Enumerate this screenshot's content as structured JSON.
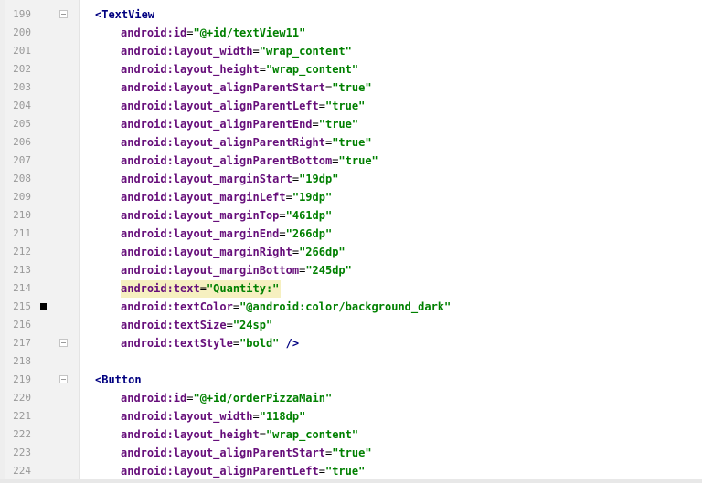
{
  "editor": {
    "lines": [
      {
        "num": "199",
        "kind": "tag",
        "text": "<TextView",
        "fold": true
      },
      {
        "num": "200",
        "kind": "attr",
        "name": "android:id",
        "value": "\"@+id/textView11\""
      },
      {
        "num": "201",
        "kind": "attr",
        "name": "android:layout_width",
        "value": "\"wrap_content\""
      },
      {
        "num": "202",
        "kind": "attr",
        "name": "android:layout_height",
        "value": "\"wrap_content\""
      },
      {
        "num": "203",
        "kind": "attr",
        "name": "android:layout_alignParentStart",
        "value": "\"true\""
      },
      {
        "num": "204",
        "kind": "attr",
        "name": "android:layout_alignParentLeft",
        "value": "\"true\""
      },
      {
        "num": "205",
        "kind": "attr",
        "name": "android:layout_alignParentEnd",
        "value": "\"true\""
      },
      {
        "num": "206",
        "kind": "attr",
        "name": "android:layout_alignParentRight",
        "value": "\"true\""
      },
      {
        "num": "207",
        "kind": "attr",
        "name": "android:layout_alignParentBottom",
        "value": "\"true\""
      },
      {
        "num": "208",
        "kind": "attr",
        "name": "android:layout_marginStart",
        "value": "\"19dp\""
      },
      {
        "num": "209",
        "kind": "attr",
        "name": "android:layout_marginLeft",
        "value": "\"19dp\""
      },
      {
        "num": "210",
        "kind": "attr",
        "name": "android:layout_marginTop",
        "value": "\"461dp\""
      },
      {
        "num": "211",
        "kind": "attr",
        "name": "android:layout_marginEnd",
        "value": "\"266dp\""
      },
      {
        "num": "212",
        "kind": "attr",
        "name": "android:layout_marginRight",
        "value": "\"266dp\""
      },
      {
        "num": "213",
        "kind": "attr",
        "name": "android:layout_marginBottom",
        "value": "\"245dp\""
      },
      {
        "num": "214",
        "kind": "attr",
        "name": "android:text",
        "value": "\"Quantity:\"",
        "highlight": true
      },
      {
        "num": "215",
        "kind": "attr",
        "name": "android:textColor",
        "value": "\"@android:color/background_dark\"",
        "marker": true
      },
      {
        "num": "216",
        "kind": "attr",
        "name": "android:textSize",
        "value": "\"24sp\""
      },
      {
        "num": "217",
        "kind": "attr",
        "name": "android:textStyle",
        "value": "\"bold\"",
        "tail": " />",
        "fold": true
      },
      {
        "num": "218",
        "kind": "blank"
      },
      {
        "num": "219",
        "kind": "tag",
        "text": "<Button",
        "fold": true
      },
      {
        "num": "220",
        "kind": "attr",
        "name": "android:id",
        "value": "\"@+id/orderPizzaMain\""
      },
      {
        "num": "221",
        "kind": "attr",
        "name": "android:layout_width",
        "value": "\"118dp\""
      },
      {
        "num": "222",
        "kind": "attr",
        "name": "android:layout_height",
        "value": "\"wrap_content\""
      },
      {
        "num": "223",
        "kind": "attr",
        "name": "android:layout_alignParentStart",
        "value": "\"true\""
      },
      {
        "num": "224",
        "kind": "attr",
        "name": "android:layout_alignParentLeft",
        "value": "\"true\""
      }
    ]
  },
  "colors": {
    "gutter_bg": "#f2f2f2",
    "line_number": "#999999",
    "tag": "#000080",
    "attribute_name": "#660e7a",
    "attribute_value": "#008000",
    "highlight_bg": "#f6f0c0",
    "marker": "#000000"
  }
}
